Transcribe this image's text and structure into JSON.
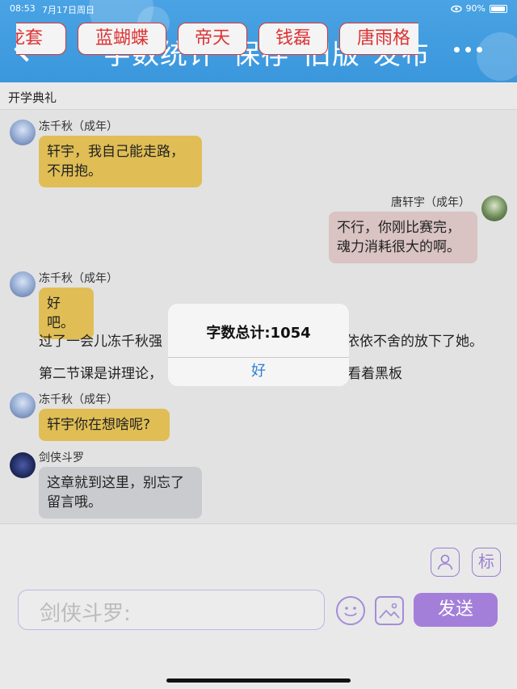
{
  "status": {
    "time": "08:53",
    "date": "7月17日周日",
    "battery": "90%"
  },
  "nav": {
    "word_count": "字数统计",
    "save": "保存",
    "old_version": "旧版",
    "publish": "发布"
  },
  "chapter_title": "开学典礼",
  "messages": [
    {
      "name": "冻千秋（成年）",
      "text_lines": [
        "轩宇，我自己能走路，",
        "不用抱。"
      ]
    },
    {
      "name": "唐轩宇（成年）",
      "text_lines": [
        "不行，你刚比赛完，",
        "魂力消耗很大的啊。"
      ]
    },
    {
      "name": "冻千秋（成年）",
      "text_lines": [
        "好吧。"
      ]
    },
    {
      "name": "冻千秋（成年）",
      "text_lines": [
        "轩宇你在想啥呢?"
      ]
    },
    {
      "name": "剑侠斗罗",
      "text_lines": [
        "这章就到这里，别忘了",
        "留言哦。"
      ]
    }
  ],
  "narration": {
    "line1_left": "过了一会儿冻千秋强",
    "line1_right": "依依不舍的放下了她。",
    "line2_left": "第二节课是讲理论，",
    "line2_right": "看着黑板"
  },
  "dialog": {
    "message": "字数总计:1054",
    "ok": "好"
  },
  "chips": [
    "龙套",
    "蓝蝴蝶",
    "帝天",
    "钱磊",
    "唐雨格"
  ],
  "tools": {
    "tag_label": "标"
  },
  "input": {
    "placeholder": "剑侠斗罗:"
  },
  "send_label": "发送",
  "colors": {
    "nav": "#49a3e4",
    "bubble_yellow": "#e0be55",
    "bubble_pink": "#d9c3c3",
    "bubble_gray": "#c9cbce",
    "chip_red": "#dd3333",
    "send": "#a47fda"
  }
}
